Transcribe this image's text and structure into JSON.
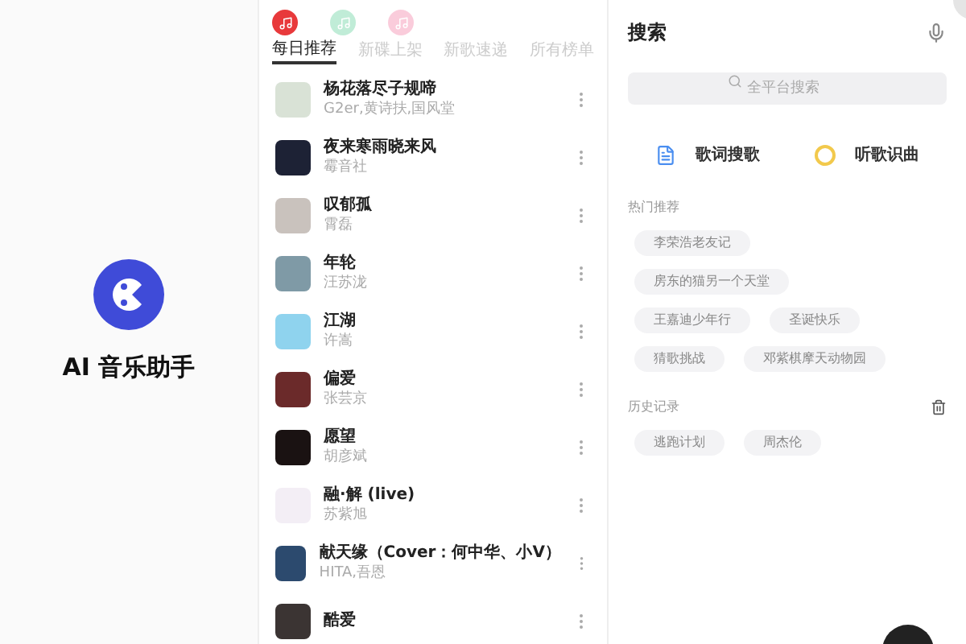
{
  "app": {
    "title": "AI 音乐助手"
  },
  "sources": [
    {
      "kind": "netease",
      "selected": true
    },
    {
      "kind": "qq",
      "selected": false
    },
    {
      "kind": "apple",
      "selected": false
    }
  ],
  "tabs": [
    {
      "label": "每日推荐",
      "selected": true
    },
    {
      "label": "新碟上架",
      "selected": false
    },
    {
      "label": "新歌速递",
      "selected": false
    },
    {
      "label": "所有榜单",
      "selected": false
    }
  ],
  "songs": [
    {
      "title": "杨花落尽子规啼",
      "artist": "G2er,黄诗扶,国风堂"
    },
    {
      "title": "夜来寒雨晓来风",
      "artist": "霉音社"
    },
    {
      "title": "叹郁孤",
      "artist": "霄磊"
    },
    {
      "title": "年轮",
      "artist": "汪苏泷"
    },
    {
      "title": "江湖",
      "artist": "许嵩"
    },
    {
      "title": "偏爱",
      "artist": "张芸京"
    },
    {
      "title": "愿望",
      "artist": "胡彦斌"
    },
    {
      "title": "融·解 (live)",
      "artist": "苏紫旭"
    },
    {
      "title": "献天缘（Cover：何中华、小V）",
      "artist": "HITA,吾恩"
    },
    {
      "title": "酷爱"
    }
  ],
  "search": {
    "title": "搜索",
    "placeholder": "全平台搜索",
    "actions": [
      {
        "kind": "lyrics",
        "label": "歌词搜歌"
      },
      {
        "kind": "listen",
        "label": "听歌识曲"
      }
    ]
  },
  "hot": {
    "title": "热门推荐",
    "tags": [
      "李荣浩老友记",
      "房东的猫另一个天堂",
      "王嘉迪少年行",
      "圣诞快乐",
      "猜歌挑战",
      "邓紫棋摩天动物园"
    ]
  },
  "history": {
    "title": "历史记录",
    "tags": [
      "逃跑计划",
      "周杰伦"
    ]
  }
}
